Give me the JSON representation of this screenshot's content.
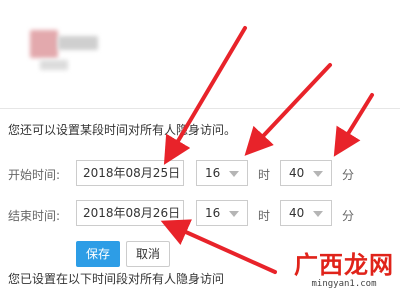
{
  "form": {
    "description": "您还可以设置某段时间对所有人隐身访问。",
    "start": {
      "label": "开始时间:",
      "date": "2018年08月25日",
      "hour": "16",
      "hour_unit": "时",
      "minute": "40",
      "minute_unit": "分"
    },
    "end": {
      "label": "结束时间:",
      "date": "2018年08月26日",
      "hour": "16",
      "hour_unit": "时",
      "minute": "40",
      "minute_unit": "分"
    },
    "buttons": {
      "save": "保存",
      "cancel": "取消"
    },
    "status": "您已设置在以下时间段对所有人隐身访问"
  },
  "watermark": {
    "logo": "广西龙网",
    "url": "mingyan1.com"
  },
  "colors": {
    "accent": "#2d9de6",
    "arrow": "#e8232a",
    "watermark": "#e0231a"
  }
}
